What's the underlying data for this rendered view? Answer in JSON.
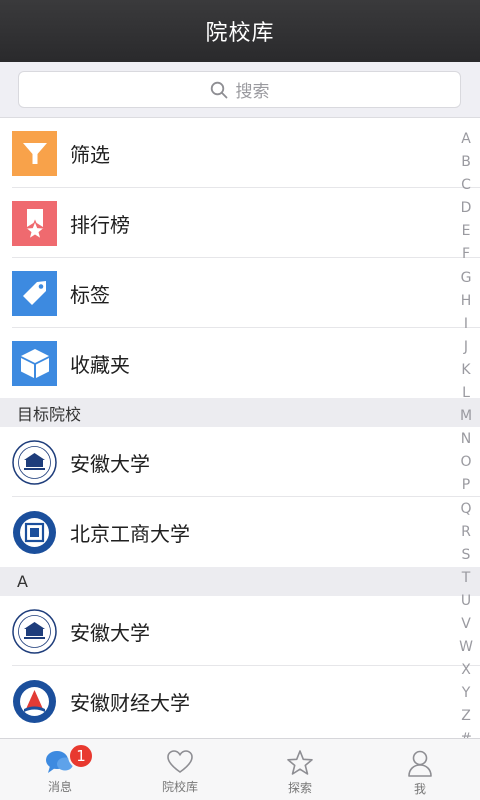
{
  "header": {
    "title": "院校库"
  },
  "search": {
    "placeholder": "搜索"
  },
  "menu": [
    {
      "label": "筛选",
      "icon": "filter-icon",
      "color": "#f8a24a"
    },
    {
      "label": "排行榜",
      "icon": "award-ribbon-icon",
      "color": "#ef6a6f"
    },
    {
      "label": "标签",
      "icon": "tag-icon",
      "color": "#3d8ae0"
    },
    {
      "label": "收藏夹",
      "icon": "cube-icon",
      "color": "#3d8ae0"
    }
  ],
  "target_section": {
    "title": "目标院校",
    "items": [
      {
        "name": "安徽大学"
      },
      {
        "name": "北京工商大学"
      }
    ]
  },
  "a_section": {
    "title": "A",
    "items": [
      {
        "name": "安徽大学"
      },
      {
        "name": "安徽财经大学"
      }
    ]
  },
  "index_letters": [
    "A",
    "B",
    "C",
    "D",
    "E",
    "F",
    "G",
    "H",
    "I",
    "J",
    "K",
    "L",
    "M",
    "N",
    "O",
    "P",
    "Q",
    "R",
    "S",
    "T",
    "U",
    "V",
    "W",
    "X",
    "Y",
    "Z",
    "#"
  ],
  "tabs": [
    {
      "label": "消息",
      "icon": "chat-bubbles-icon",
      "badge": "1",
      "active": true
    },
    {
      "label": "院校库",
      "icon": "heart-icon"
    },
    {
      "label": "探索",
      "icon": "star-icon"
    },
    {
      "label": "我",
      "icon": "person-icon"
    }
  ],
  "colors": {
    "header_bg": "#2f2f31",
    "active_tab": "#3d8ae0",
    "badge": "#e8392f"
  }
}
